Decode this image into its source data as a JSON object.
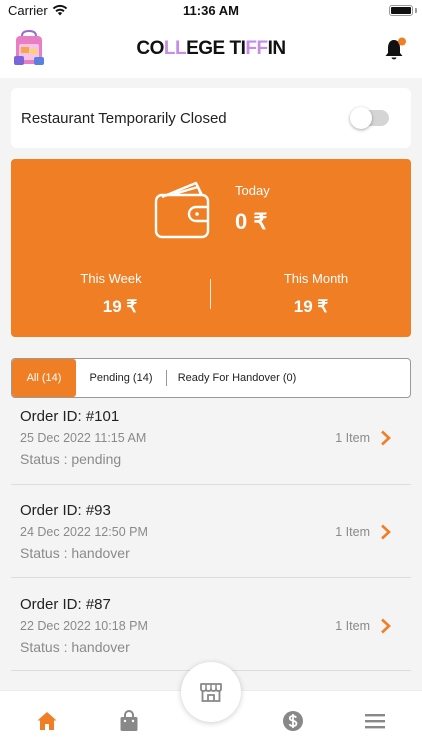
{
  "status_bar": {
    "carrier": "Carrier",
    "time": "11:36 AM"
  },
  "header": {
    "brand_prefix": "CO",
    "brand_highlight": "LL",
    "brand_mid": "EGE TI",
    "brand_highlight2": "FF",
    "brand_suffix": "IN",
    "highlight_color": "#c78be8",
    "notification_dot_color": "#f07e24"
  },
  "closed": {
    "label": "Restaurant Temporarily Closed",
    "toggle_on": false
  },
  "earnings": {
    "accent_color": "#f07e24",
    "today_label": "Today",
    "today_value": "0 ₹",
    "week_label": "This Week",
    "week_value": "19 ₹",
    "month_label": "This Month",
    "month_value": "19 ₹"
  },
  "tabs": [
    {
      "label": "All (14)",
      "active": true
    },
    {
      "label": "Pending (14)",
      "active": false
    },
    {
      "label": "Ready For Handover (0)",
      "active": false
    }
  ],
  "orders": [
    {
      "title": "Order ID: #101",
      "datetime": "25 Dec 2022  11:15 AM",
      "status": "Status : pending",
      "items": "1 Item"
    },
    {
      "title": "Order ID: #93",
      "datetime": "24 Dec 2022  12:50 PM",
      "status": "Status : handover",
      "items": "1 Item"
    },
    {
      "title": "Order ID: #87",
      "datetime": "22 Dec 2022  10:18 PM",
      "status": "Status : handover",
      "items": "1 Item"
    }
  ],
  "bottom_nav": {
    "items": [
      "home-icon",
      "bag-icon",
      "store-icon",
      "dollar-icon",
      "menu-icon"
    ],
    "active": "home-icon"
  }
}
